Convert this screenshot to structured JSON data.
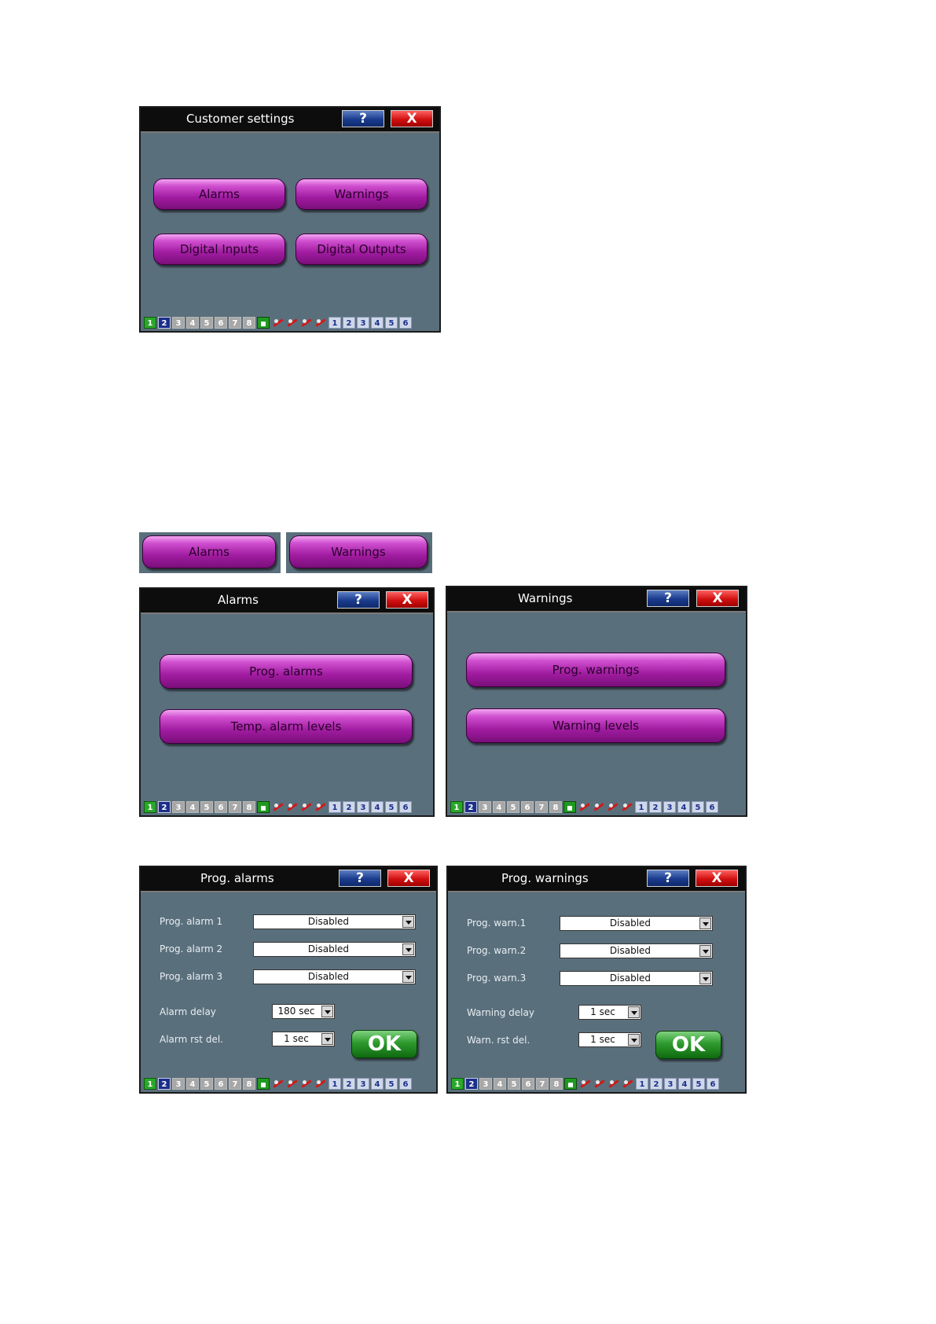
{
  "common": {
    "help_label": "?",
    "close_label": "X",
    "ok_label": "OK",
    "status_green": "1",
    "status_blue": "2",
    "status_gray": [
      "3",
      "4",
      "5",
      "6",
      "7",
      "8"
    ],
    "status_light": [
      "1",
      "2",
      "3",
      "4",
      "5",
      "6"
    ]
  },
  "customer_settings": {
    "title": "Customer settings",
    "buttons": [
      "Alarms",
      "Warnings",
      "Digital Inputs",
      "Digital Outputs"
    ]
  },
  "crops": {
    "alarms": "Alarms",
    "warnings": "Warnings"
  },
  "alarms_screen": {
    "title": "Alarms",
    "buttons": [
      "Prog. alarms",
      "Temp. alarm levels"
    ]
  },
  "warnings_screen": {
    "title": "Warnings",
    "buttons": [
      "Prog. warnings",
      "Warning levels"
    ]
  },
  "prog_alarms": {
    "title": "Prog. alarms",
    "rows": [
      {
        "label": "Prog. alarm 1",
        "value": "Disabled"
      },
      {
        "label": "Prog. alarm 2",
        "value": "Disabled"
      },
      {
        "label": "Prog. alarm 3",
        "value": "Disabled"
      },
      {
        "label": "Alarm delay",
        "value": "180 sec"
      },
      {
        "label": "Alarm rst del.",
        "value": "1 sec"
      }
    ]
  },
  "prog_warnings": {
    "title": "Prog. warnings",
    "rows": [
      {
        "label": "Prog. warn.1",
        "value": "Disabled"
      },
      {
        "label": "Prog. warn.2",
        "value": "Disabled"
      },
      {
        "label": "Prog. warn.3",
        "value": "Disabled"
      },
      {
        "label": "Warning delay",
        "value": "1 sec"
      },
      {
        "label": "Warn. rst del.",
        "value": "1 sec"
      }
    ]
  }
}
